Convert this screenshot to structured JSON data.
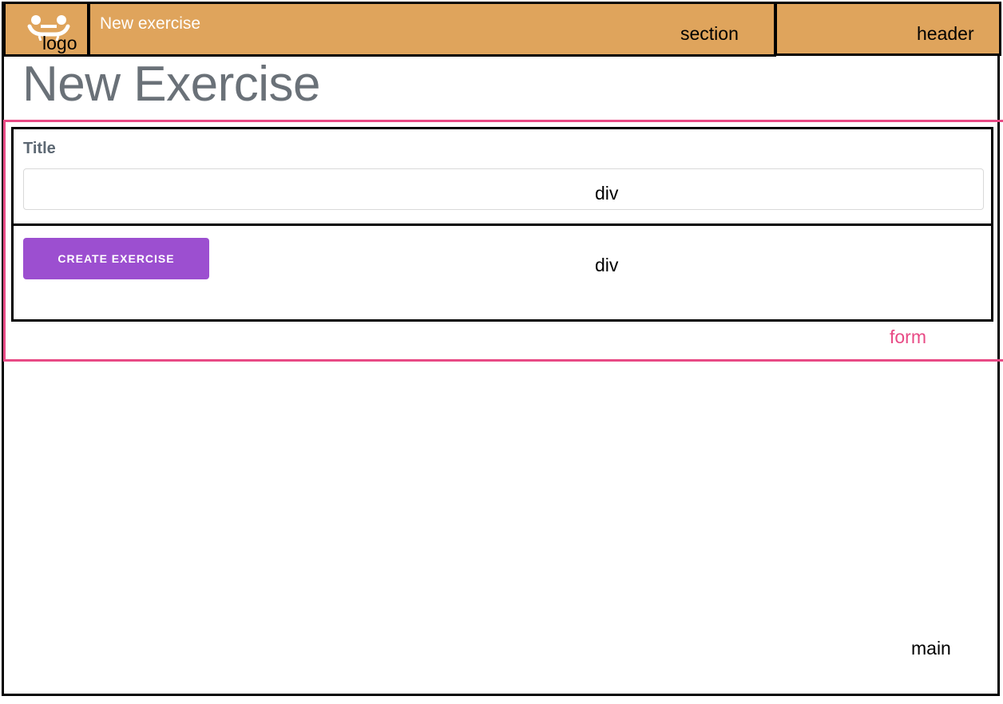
{
  "header": {
    "logo_label": "logo",
    "app_title": "New exercise",
    "section_label": "section",
    "header_label": "header",
    "background_color": "#dfa45c"
  },
  "page": {
    "title": "New Exercise"
  },
  "form": {
    "label": "form",
    "title_field": {
      "label": "Title",
      "value": "",
      "placeholder": ""
    },
    "div_label_1": "div",
    "div_label_2": "div",
    "submit_label": "CREATE EXERCISE",
    "button_color": "#9c4fd0",
    "outline_color": "#e84a85"
  },
  "main": {
    "label": "main"
  }
}
